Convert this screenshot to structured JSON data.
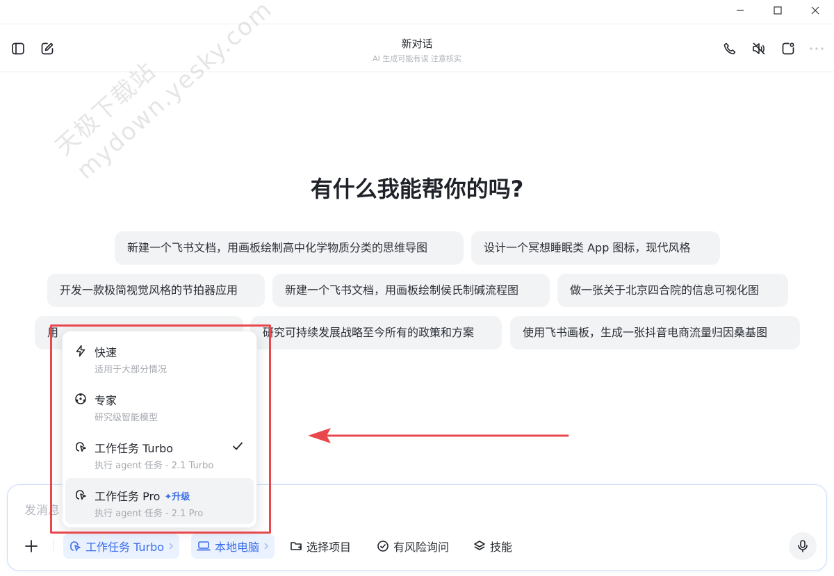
{
  "window": {
    "controls": [
      "minimize",
      "maximize",
      "close"
    ]
  },
  "header": {
    "title": "新对话",
    "subtitle": "AI 生成可能有误 注意核实",
    "left_icons": [
      "sidebar-toggle-icon",
      "new-chat-icon"
    ],
    "right_icons": [
      "phone-icon",
      "mute-icon",
      "share-icon",
      "more-icon"
    ]
  },
  "watermark": {
    "line1": "天极下载站",
    "line2": "mydown.yesky.com"
  },
  "greeting": "有什么我能帮你的吗?",
  "suggestions": [
    "新建一个飞书文档，用画板绘制高中化学物质分类的思维导图",
    "设计一个冥想睡眠类 App 图标，现代风格",
    "开发一款极简视觉风格的节拍器应用",
    "新建一个飞书文档，用画板绘制侯氏制碱流程图",
    "做一张关于北京四合院的信息可视化图",
    "用",
    "研究可持续发展战略至今所有的政策和方案",
    "使用飞书画板，生成一张抖音电商流量归因桑基图"
  ],
  "model_menu": {
    "items": [
      {
        "title": "快速",
        "desc": "适用于大部分情况",
        "icon": "lightning-icon"
      },
      {
        "title": "专家",
        "desc": "研究级智能模型",
        "icon": "expert-icon"
      },
      {
        "title": "工作任务 Turbo",
        "desc": "执行 agent 任务 - 2.1 Turbo",
        "icon": "agent-icon",
        "selected": true
      },
      {
        "title": "工作任务 Pro",
        "badge": "升级",
        "desc": "执行 agent 任务 - 2.1 Pro",
        "icon": "agent-icon"
      }
    ]
  },
  "input": {
    "placeholder": "发消息",
    "mode_label": "工作任务 Turbo",
    "device_label": "本地电脑",
    "project_label": "选择项目",
    "risk_label": "有风险询问",
    "skills_label": "技能"
  },
  "colors": {
    "accent": "#3a6ee8",
    "annotation": "#e8474c",
    "chip_bg": "#f2f3f5"
  }
}
